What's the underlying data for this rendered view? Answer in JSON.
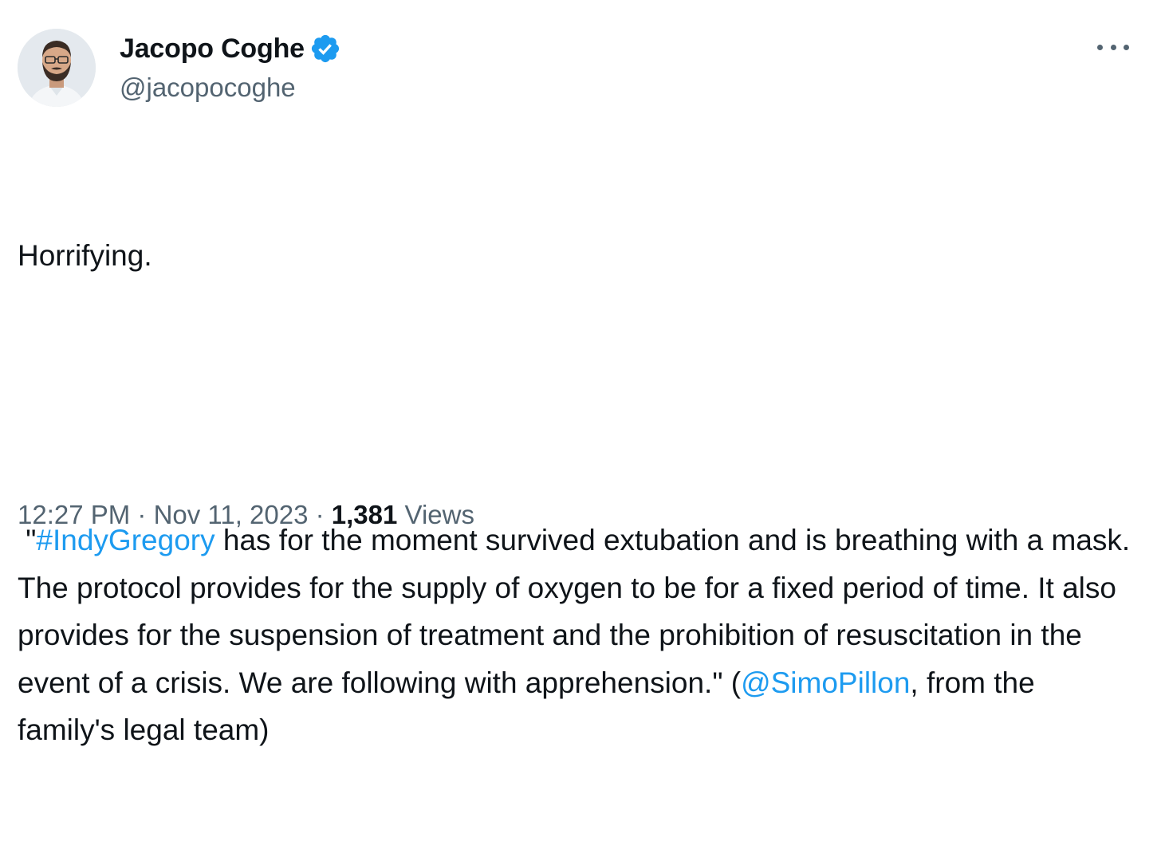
{
  "author": {
    "display_name": "Jacopo Coghe",
    "handle": "@jacopocoghe",
    "verified": true,
    "avatar_icon": "profile-photo-man-with-beard-and-glasses"
  },
  "colors": {
    "link": "#1d9bf0",
    "verified_badge": "#1d9bf0",
    "secondary_text": "#536471",
    "primary_text": "#0f1419"
  },
  "tweet": {
    "line1": "Horrifying.",
    "quote_open": " \"",
    "hashtag": "#IndyGregory",
    "body": " has for the moment survived extubation and is breathing with a mask. The protocol provides for the supply of oxygen to be for a fixed period of time. It also provides for the suspension of treatment and the prohibition of resuscitation in the event of a crisis. We are following with apprehension.\" (",
    "mention": "@SimoPillon",
    "tail": ", from the family's legal team)"
  },
  "meta": {
    "time": "12:27 PM",
    "separator": " · ",
    "date": "Nov 11, 2023",
    "views_count": "1,381",
    "views_label": " Views"
  }
}
